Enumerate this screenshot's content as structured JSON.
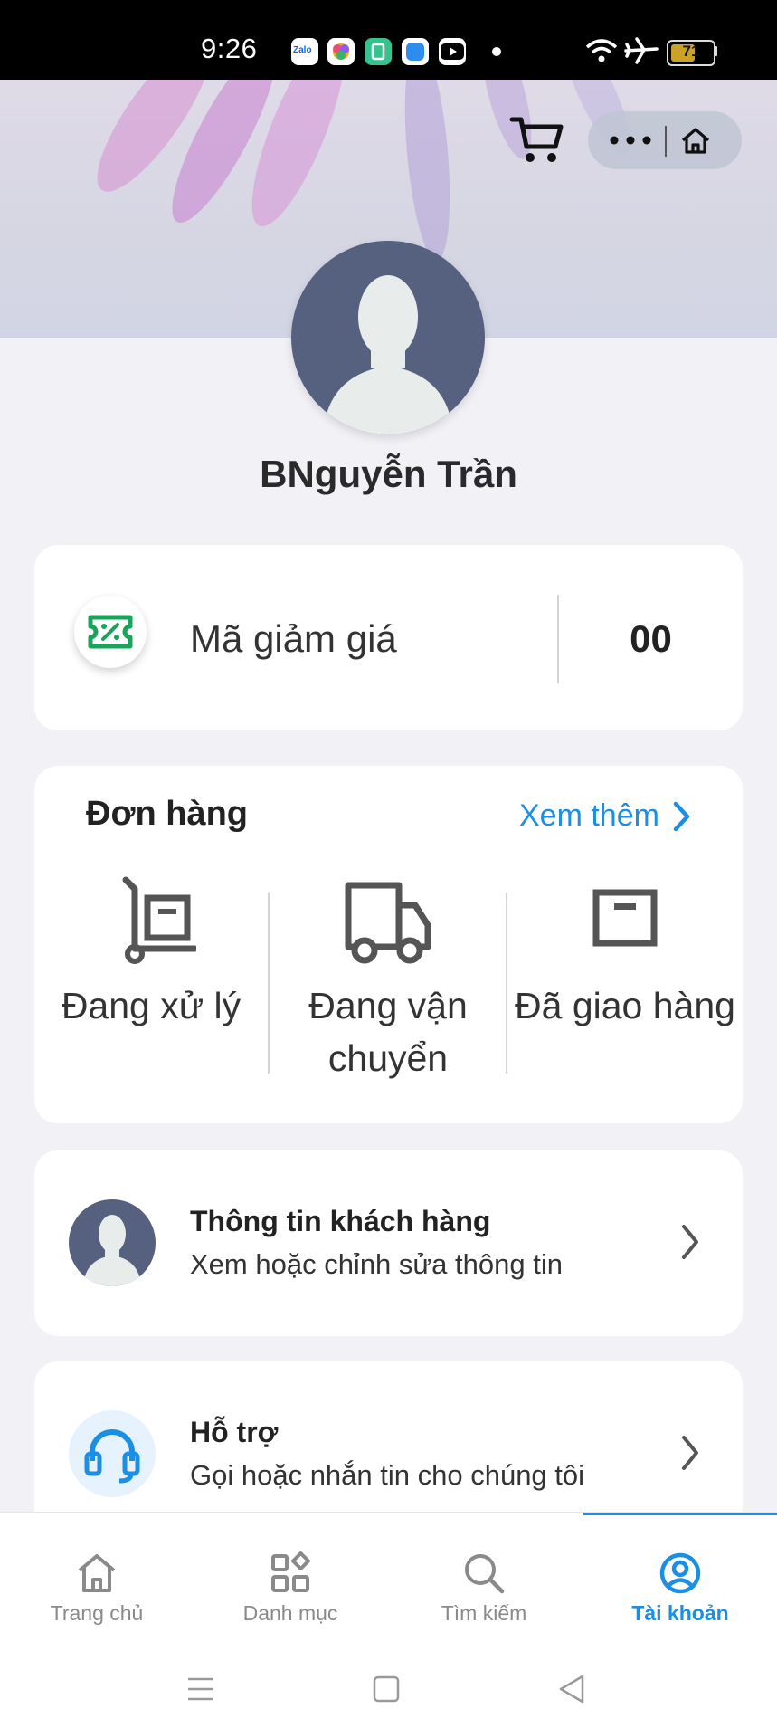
{
  "status_bar": {
    "time": "9:26",
    "battery": "71",
    "app_icons": [
      "zalo-icon",
      "photos-icon",
      "app-icon",
      "files-icon",
      "youtube-icon"
    ]
  },
  "profile": {
    "name": "BNguyễn Trần"
  },
  "coupon": {
    "label": "Mã giảm giá",
    "count": "00"
  },
  "orders": {
    "title": "Đơn hàng",
    "see_more": "Xem thêm",
    "items": [
      {
        "label": "Đang xử lý",
        "icon": "cart-dolly-icon"
      },
      {
        "label": "Đang vận chuyển",
        "icon": "delivery-truck-icon"
      },
      {
        "label": "Đã giao hàng",
        "icon": "box-icon"
      }
    ]
  },
  "menu": {
    "customer_info": {
      "title": "Thông tin khách hàng",
      "subtitle": "Xem hoặc chỉnh sửa thông tin"
    },
    "support": {
      "title": "Hỗ trợ",
      "subtitle": "Gọi hoặc nhắn tin cho chúng tôi"
    }
  },
  "bottom_nav": {
    "items": [
      {
        "label": "Trang chủ",
        "icon": "home-icon"
      },
      {
        "label": "Danh mục",
        "icon": "category-icon"
      },
      {
        "label": "Tìm kiếm",
        "icon": "search-icon"
      },
      {
        "label": "Tài khoản",
        "icon": "account-icon",
        "active": true
      }
    ]
  },
  "colors": {
    "accent": "#1a8fe3",
    "avatar_bg": "#56607f",
    "coupon_green": "#1aa35a"
  }
}
